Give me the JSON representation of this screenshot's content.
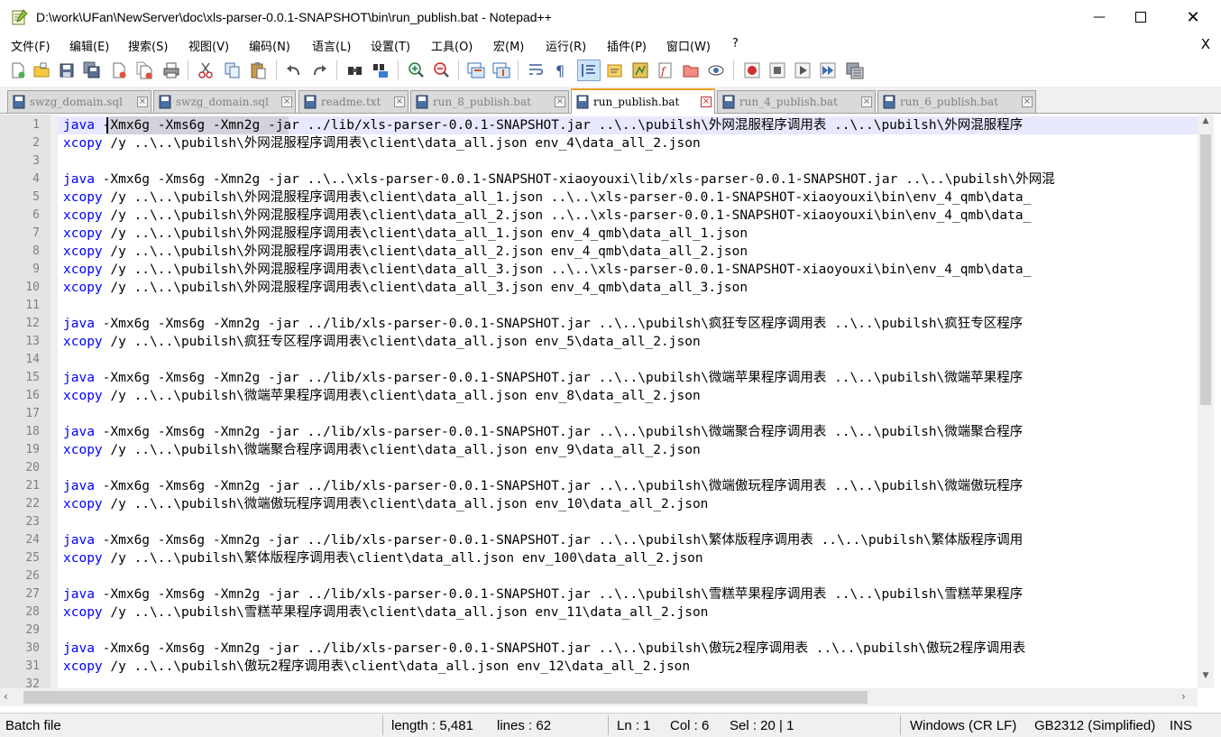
{
  "window": {
    "title": "D:\\work\\UFan\\NewServer\\doc\\xls-parser-0.0.1-SNAPSHOT\\bin\\run_publish.bat - Notepad++",
    "minimize_glyph": "—",
    "close_glyph": "✕"
  },
  "menu": {
    "items": [
      "文件(F)",
      "编辑(E)",
      "搜索(S)",
      "视图(V)",
      "编码(N)",
      "语言(L)",
      "设置(T)",
      "工具(O)",
      "宏(M)",
      "运行(R)",
      "插件(P)",
      "窗口(W)",
      "?"
    ],
    "close_glyph": "X"
  },
  "toolbar": {
    "icons": [
      "new-file-icon",
      "open-file-icon",
      "save-icon",
      "save-all-icon",
      "close-icon",
      "close-all-icon",
      "print-icon",
      "cut-icon",
      "copy-icon",
      "paste-icon",
      "undo-icon",
      "redo-icon",
      "find-icon",
      "replace-icon",
      "zoom-in-icon",
      "zoom-out-icon",
      "sync-vertical-icon",
      "sync-horizontal-icon",
      "word-wrap-icon",
      "show-all-chars-icon",
      "indent-guide-icon",
      "user-language-icon",
      "doc-map-icon",
      "function-list-icon",
      "folder-workspace-icon",
      "monitoring-icon",
      "record-macro-icon",
      "stop-record-icon",
      "play-macro-icon",
      "run-macro-multiple-icon",
      "save-macro-icon"
    ]
  },
  "tabs": [
    {
      "label": "swzg_domain.sql",
      "active": false
    },
    {
      "label": "swzg_domain.sql",
      "active": false
    },
    {
      "label": "readme.txt",
      "active": false
    },
    {
      "label": "run_8_publish.bat",
      "active": false
    },
    {
      "label": "run_publish.bat",
      "active": true
    },
    {
      "label": "run_4_publish.bat",
      "active": false
    },
    {
      "label": "run_6_publish.bat",
      "active": false
    }
  ],
  "editor": {
    "lines": [
      {
        "n": "1",
        "kw": "java",
        "rest": " -Xmx6g -Xms6g -Xmn2g -jar ../lib/xls-parser-0.0.1-SNAPSHOT.jar ..\\..\\pubilsh\\外网混服程序调用表 ..\\..\\pubilsh\\外网混服程序"
      },
      {
        "n": "2",
        "kw": "xcopy",
        "rest": " /y ..\\..\\pubilsh\\外网混服程序调用表\\client\\data_all.json env_4\\data_all_2.json"
      },
      {
        "n": "3",
        "kw": "",
        "rest": ""
      },
      {
        "n": "4",
        "kw": "java",
        "rest": " -Xmx6g -Xms6g -Xmn2g -jar ..\\..\\xls-parser-0.0.1-SNAPSHOT-xiaoyouxi\\lib/xls-parser-0.0.1-SNAPSHOT.jar ..\\..\\pubilsh\\外网混"
      },
      {
        "n": "5",
        "kw": "xcopy",
        "rest": " /y ..\\..\\pubilsh\\外网混服程序调用表\\client\\data_all_1.json ..\\..\\xls-parser-0.0.1-SNAPSHOT-xiaoyouxi\\bin\\env_4_qmb\\data_"
      },
      {
        "n": "6",
        "kw": "xcopy",
        "rest": " /y ..\\..\\pubilsh\\外网混服程序调用表\\client\\data_all_2.json ..\\..\\xls-parser-0.0.1-SNAPSHOT-xiaoyouxi\\bin\\env_4_qmb\\data_"
      },
      {
        "n": "7",
        "kw": "xcopy",
        "rest": " /y ..\\..\\pubilsh\\外网混服程序调用表\\client\\data_all_1.json env_4_qmb\\data_all_1.json"
      },
      {
        "n": "8",
        "kw": "xcopy",
        "rest": " /y ..\\..\\pubilsh\\外网混服程序调用表\\client\\data_all_2.json env_4_qmb\\data_all_2.json"
      },
      {
        "n": "9",
        "kw": "xcopy",
        "rest": " /y ..\\..\\pubilsh\\外网混服程序调用表\\client\\data_all_3.json ..\\..\\xls-parser-0.0.1-SNAPSHOT-xiaoyouxi\\bin\\env_4_qmb\\data_"
      },
      {
        "n": "10",
        "kw": "xcopy",
        "rest": " /y ..\\..\\pubilsh\\外网混服程序调用表\\client\\data_all_3.json env_4_qmb\\data_all_3.json"
      },
      {
        "n": "11",
        "kw": "",
        "rest": ""
      },
      {
        "n": "12",
        "kw": "java",
        "rest": " -Xmx6g -Xms6g -Xmn2g -jar ../lib/xls-parser-0.0.1-SNAPSHOT.jar ..\\..\\pubilsh\\疯狂专区程序调用表 ..\\..\\pubilsh\\疯狂专区程序"
      },
      {
        "n": "13",
        "kw": "xcopy",
        "rest": " /y ..\\..\\pubilsh\\疯狂专区程序调用表\\client\\data_all.json env_5\\data_all_2.json"
      },
      {
        "n": "14",
        "kw": "",
        "rest": ""
      },
      {
        "n": "15",
        "kw": "java",
        "rest": " -Xmx6g -Xms6g -Xmn2g -jar ../lib/xls-parser-0.0.1-SNAPSHOT.jar ..\\..\\pubilsh\\微端苹果程序调用表 ..\\..\\pubilsh\\微端苹果程序"
      },
      {
        "n": "16",
        "kw": "xcopy",
        "rest": " /y ..\\..\\pubilsh\\微端苹果程序调用表\\client\\data_all.json env_8\\data_all_2.json"
      },
      {
        "n": "17",
        "kw": "",
        "rest": ""
      },
      {
        "n": "18",
        "kw": "java",
        "rest": " -Xmx6g -Xms6g -Xmn2g -jar ../lib/xls-parser-0.0.1-SNAPSHOT.jar ..\\..\\pubilsh\\微端聚合程序调用表 ..\\..\\pubilsh\\微端聚合程序"
      },
      {
        "n": "19",
        "kw": "xcopy",
        "rest": " /y ..\\..\\pubilsh\\微端聚合程序调用表\\client\\data_all.json env_9\\data_all_2.json"
      },
      {
        "n": "20",
        "kw": "",
        "rest": ""
      },
      {
        "n": "21",
        "kw": "java",
        "rest": " -Xmx6g -Xms6g -Xmn2g -jar ../lib/xls-parser-0.0.1-SNAPSHOT.jar ..\\..\\pubilsh\\微端傲玩程序调用表 ..\\..\\pubilsh\\微端傲玩程序"
      },
      {
        "n": "22",
        "kw": "xcopy",
        "rest": " /y ..\\..\\pubilsh\\微端傲玩程序调用表\\client\\data_all.json env_10\\data_all_2.json"
      },
      {
        "n": "23",
        "kw": "",
        "rest": ""
      },
      {
        "n": "24",
        "kw": "java",
        "rest": " -Xmx6g -Xms6g -Xmn2g -jar ../lib/xls-parser-0.0.1-SNAPSHOT.jar ..\\..\\pubilsh\\繁体版程序调用表 ..\\..\\pubilsh\\繁体版程序调用"
      },
      {
        "n": "25",
        "kw": "xcopy",
        "rest": " /y ..\\..\\pubilsh\\繁体版程序调用表\\client\\data_all.json env_100\\data_all_2.json"
      },
      {
        "n": "26",
        "kw": "",
        "rest": ""
      },
      {
        "n": "27",
        "kw": "java",
        "rest": " -Xmx6g -Xms6g -Xmn2g -jar ../lib/xls-parser-0.0.1-SNAPSHOT.jar ..\\..\\pubilsh\\雪糕苹果程序调用表 ..\\..\\pubilsh\\雪糕苹果程序"
      },
      {
        "n": "28",
        "kw": "xcopy",
        "rest": " /y ..\\..\\pubilsh\\雪糕苹果程序调用表\\client\\data_all.json env_11\\data_all_2.json"
      },
      {
        "n": "29",
        "kw": "",
        "rest": ""
      },
      {
        "n": "30",
        "kw": "java",
        "rest": " -Xmx6g -Xms6g -Xmn2g -jar ../lib/xls-parser-0.0.1-SNAPSHOT.jar ..\\..\\pubilsh\\傲玩2程序调用表 ..\\..\\pubilsh\\傲玩2程序调用表"
      },
      {
        "n": "31",
        "kw": "xcopy",
        "rest": " /y ..\\..\\pubilsh\\傲玩2程序调用表\\client\\data_all.json env_12\\data_all_2.json"
      },
      {
        "n": "32",
        "kw": "",
        "rest": ""
      }
    ]
  },
  "status": {
    "file_type": "Batch file",
    "length": "length : 5,481",
    "lines": "lines : 62",
    "ln": "Ln : 1",
    "col": "Col : 6",
    "sel": "Sel : 20 | 1",
    "eol": "Windows (CR LF)",
    "encoding": "GB2312 (Simplified)",
    "mode": "INS"
  },
  "colors": {
    "keyword": "#0000ff",
    "active_tab_accent": "#f0a020",
    "current_line": "#e8e8ff"
  }
}
